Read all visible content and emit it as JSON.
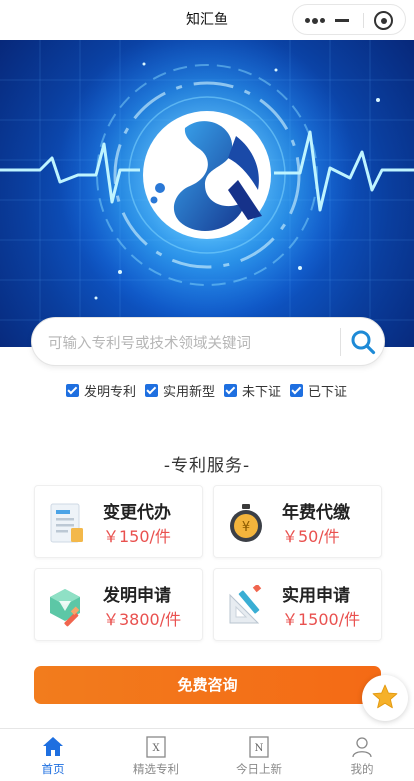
{
  "app": {
    "title": "知汇鱼"
  },
  "search": {
    "placeholder": "可输入专利号或技术领域关键词"
  },
  "filters": [
    {
      "label": "发明专利",
      "checked": true
    },
    {
      "label": "实用新型",
      "checked": true
    },
    {
      "label": "未下证",
      "checked": true
    },
    {
      "label": "已下证",
      "checked": true
    }
  ],
  "section": {
    "title": "-专利服务-"
  },
  "services": [
    {
      "name": "变更代办",
      "price": "￥150/件",
      "icon": "document-icon"
    },
    {
      "name": "年费代缴",
      "price": "￥50/件",
      "icon": "stopwatch-coin-icon"
    },
    {
      "name": "发明申请",
      "price": "￥3800/件",
      "icon": "cube-pen-icon"
    },
    {
      "name": "实用申请",
      "price": "￥1500/件",
      "icon": "ruler-pencil-icon"
    }
  ],
  "consult": {
    "label": "免费咨询"
  },
  "tabs": [
    {
      "label": "首页",
      "icon": "home-icon",
      "active": true
    },
    {
      "label": "精选专利",
      "icon": "x-doc-icon",
      "active": false
    },
    {
      "label": "今日上新",
      "icon": "n-doc-icon",
      "active": false
    },
    {
      "label": "我的",
      "icon": "user-icon",
      "active": false
    }
  ],
  "colors": {
    "accent": "#1e6fe0",
    "price": "#e9514f",
    "consult": "#f27c1d",
    "star": "#f6b12a"
  }
}
